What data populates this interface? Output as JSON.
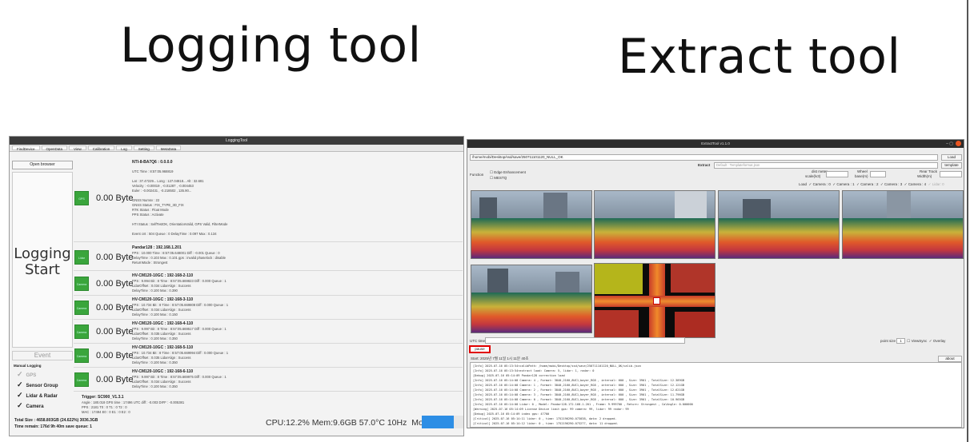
{
  "slide": {
    "title_left": "Logging tool",
    "title_right": "Extract tool"
  },
  "logging_tool": {
    "window_title": "LoggingTool",
    "tabs": [
      "FindDevice",
      "OpenData",
      "View",
      "Calibration",
      "Log",
      "Setting",
      "MetaData"
    ],
    "open_browser": "Open browser",
    "start_button": [
      "Logging",
      "Start"
    ],
    "event_button": "Event",
    "manual_logging": "Manual Logging",
    "checks": [
      {
        "label": "GPS",
        "checked": true,
        "dim": true
      },
      {
        "label": "Sensor Group",
        "checked": true,
        "dim": false
      },
      {
        "label": "Lidar & Radar",
        "checked": true,
        "dim": false
      },
      {
        "label": "Camera",
        "checked": true,
        "dim": false
      }
    ],
    "rows": [
      {
        "box": "GPS",
        "bytes": "0.00 Byte",
        "title": "NTI-8-BA7Q6 : 0.0.0.0",
        "lines": [
          "UTC Time : 8:57:05.968819",
          "Lat : 37.47229...  Long : 127.04818...  Alt : 32.681",
          "Velocity : -0.00019 , -0.01287 , -0.004453",
          "Euler : -0.002431 , -0.218502 , 135.90...",
          "GNSS Numsv : 22",
          "GNSS Status : FIX_TYPE_3D_FIX",
          "RTK Status : Float Mode",
          "PPS Status : Activate",
          "HTI Status : SelfTestOK, OrientationValid, GPS Valid, FilterMode",
          "Event cnt : 504     Queue : 0          DelayTime : 0.097  Max : 0.134"
        ]
      },
      {
        "box": "Lidar",
        "bytes": "0.00 Byte",
        "title": "Pandar128 : 192.168.1.201",
        "lines": [
          "FPS : 10.000   Time : 8:57:05.648001   Diff : -0.001   Queue : 0",
          "DelayTime : 0.103  Max : 0.101   gps : invalid   phaselock : disable",
          "ReturnMode : Strongest"
        ]
      },
      {
        "box": "Camera",
        "bytes": "0.00 Byte",
        "title": "HV-CM120-10GC : 192-168-2-110",
        "lines": [
          "FPS : 9.994   Bit : 8   Time : 8:57:05.669823   Diff : 0.000   Queue : 1",
          "LidarOffset : 0.034   LidarAlign : Success",
          "DelayTime : 0.100   Max : 0.390"
        ]
      },
      {
        "box": "Camera",
        "bytes": "0.00 Byte",
        "title": "HV-CM120-10GC : 192-168-3-110",
        "lines": [
          "FPS : 10.734   Bit : 8   Time : 8:57:05.669808   Diff : 0.000   Queue : 1",
          "LidarOffset : 0.034   LidarAlign : Success",
          "DelayTime : 0.100   Max : 0.150"
        ]
      },
      {
        "box": "Camera",
        "bytes": "0.00 Byte",
        "title": "HV-CM120-10GC : 192-168-4-110",
        "lines": [
          "FPS : 9.997   Bit : 8   Time : 8:57:05.669517   Diff : 0.000   Queue : 1",
          "LidarOffset : 0.035   LidarAlign : Success",
          "DelayTime : 0.100   Max : 0.350"
        ]
      },
      {
        "box": "Camera",
        "bytes": "0.00 Byte",
        "title": "HV-CM120-10GC : 192-168-5-110",
        "lines": [
          "FPS : 10.734   Bit : 8   Time : 8:57:05.669994   Diff : 0.000   Queue : 1",
          "LidarOffset : 0.035   LidarAlign : Success",
          "DelayTime : 0.100   Max : 0.350"
        ]
      },
      {
        "box": "Camera",
        "bytes": "0.00 Byte",
        "title": "HV-CM120-10GC : 192-168-6-110",
        "lines": [
          "FPS : 9.997   Bit : 8   Time : 8:57:05.669975   Diff : 0.000   Queue : 1",
          "LidarOffset : 0.034   LidarAlign : Success",
          "DelayTime : 0.100   Max : 0.350"
        ]
      }
    ],
    "trigger": [
      "Trigger: SC900_V1.3.1",
      "Angle : 180.018   GPS time : 17496   UTC diff : -0.003     DIFF : -0.005381",
      "PPS : 2181       T0 : 0       T1 : 0       T2 : 0",
      "MAC : 17494     E0 : 0       E1 : 0       E2 : 0"
    ],
    "total_size": "Total Size : 4658.803GB (24.622%) 3036.3GB",
    "time_remain": "Time remain: 176d 9h 40m   save queue: 1",
    "status_bar": "CPU:12.2% Mem:9.6GB 57.0°C 10Hz",
    "moving": "Moving"
  },
  "extract_tool": {
    "window_title": "ExtractTool v1.1.0",
    "path": "/home/mobi/Desktop/ssd/save/250711101120_NULL_OK",
    "load": "Load",
    "template": "template",
    "extract": "Extract",
    "extract_placeholder": "Default : Templateformat.json",
    "function_label": "Function",
    "edge_enhancement": "Edge Enhancement",
    "mestq": "MESTQ",
    "dist_meter": "dist meter",
    "scale": "scale(lv3)",
    "wheel": "Wheel",
    "base": "base(m)",
    "rear_track": "Rear Track",
    "width": "Width(m)",
    "load_label": "Load",
    "cameras": [
      "Camera : 0",
      "Camera : 1",
      "Camera : 2",
      "Camera : 3",
      "Camera : 4",
      "Lidar: 0"
    ],
    "utc_time": "UTC time",
    "point_size_label": "point size",
    "point_size_value": "1",
    "viewsync": "ViewSync",
    "overlay": "Overlay",
    "pause": "pause",
    "start_line": "Start: 2025년 7월 11일 1시 11분 40초",
    "about": "about",
    "log_lines": [
      "[Info]      2025-07-16 05:13:54<calibPath: /home/mobi/Desktop/ssd/save/250711101120_NULL_OK/calib.json",
      "[Info]      2025-07-16 05:13:54<extract load: Camera: 5, lidar: 1, radar: 0",
      "[Debug]     2025-07-16 05:14:09 Pandar128 correction load",
      "[Info]      2025-07-16 05:14:08 Camera: 4      , Format: 3840,2160,8UC1,bayer_RG8        , interval: 600       , Size: 3901 , TotalSize: 12.389GB",
      "[Info]      2025-07-16 05:14:08 Camera: 1      , Format: 3840,2160,8UC1,bayer_RG8        , interval: 600       , Size: 3901 , TotalSize: 12.121GB",
      "[Info]      2025-07-16 05:14:08 Camera: 2      , Format: 3840,2160,8UC1,bayer_RG8        , interval: 600       , Size: 3901 , TotalSize: 12.621GB",
      "[Info]      2025-07-16 05:14:08 Camera: 3      , Format: 3840,2160,8UC1,bayer_RG8        , interval: 600       , Size: 3901 , TotalSize: 11.796GB",
      "[Info]      2025-07-16 05:14:08 Camera: 0      , Format: 3840,2160,8UC1,bayer_RG8        , interval: 600       , Size: 3901 , TotalSize: 10.965GB",
      "[Info]      2025-07-16 05:14:08 Lidar: 0       , Model: Pandar128-172.168.1.201 , Frame: 9.999700      , Return: Strongest      , CalAngle: 0.000000",
      "[Warning]   2025-07-16 05:14:09 License Device limit gps: 99 camera: 99, lidar: 99 radar: 99",
      "[Debug]     2025-07-16 05:14:09 index gps: 47700",
      "[Critical]  2025-07-16 05:14:11 lidar: 0       , time: 1752196290.073038, data: 2 dropped.",
      "[Critical]  2025-07-16 05:14:12 lidar: 0       , time: 1752196290.073277, data: 11 dropped."
    ]
  }
}
